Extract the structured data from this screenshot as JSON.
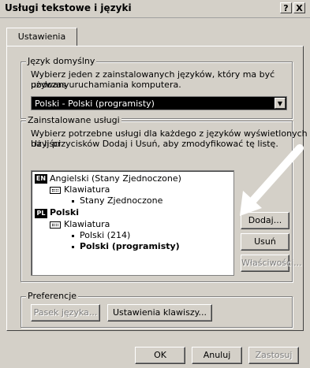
{
  "window": {
    "title": "Usługi tekstowe i języki",
    "help_btn": "?",
    "close_btn": "X"
  },
  "tabs": [
    {
      "label": "Ustawienia"
    }
  ],
  "default_language": {
    "legend": "Język domyślny",
    "desc1": "Wybierz jeden z zainstalowanych języków, który ma być używany",
    "desc2": "podczas uruchamiania komputera.",
    "selected": "Polski - Polski (programisty)"
  },
  "installed_services": {
    "legend": "Zainstalowane usługi",
    "desc1": "Wybierz potrzebne usługi dla każdego z języków wyświetlonych na liści",
    "desc2": "Użyj przycisków Dodaj i Usuń, aby zmodyfikować tę listę.",
    "tree": {
      "en_badge": "EN",
      "en_label": "Angielski (Stany Zjednoczone)",
      "en_kbd": "Klawiatura",
      "en_layout": "Stany Zjednoczone",
      "pl_badge": "PL",
      "pl_label": "Polski",
      "pl_kbd": "Klawiatura",
      "pl_layout1": "Polski (214)",
      "pl_layout2": "Polski (programisty)"
    },
    "add_btn": "Dodaj...",
    "remove_btn": "Usuń",
    "props_btn": "Właściwości..."
  },
  "preferences": {
    "legend": "Preferencje",
    "langbar_btn": "Pasek języka...",
    "keys_btn": "Ustawienia klawiszy..."
  },
  "footer": {
    "ok": "OK",
    "cancel": "Anuluj",
    "apply": "Zastosuj"
  }
}
